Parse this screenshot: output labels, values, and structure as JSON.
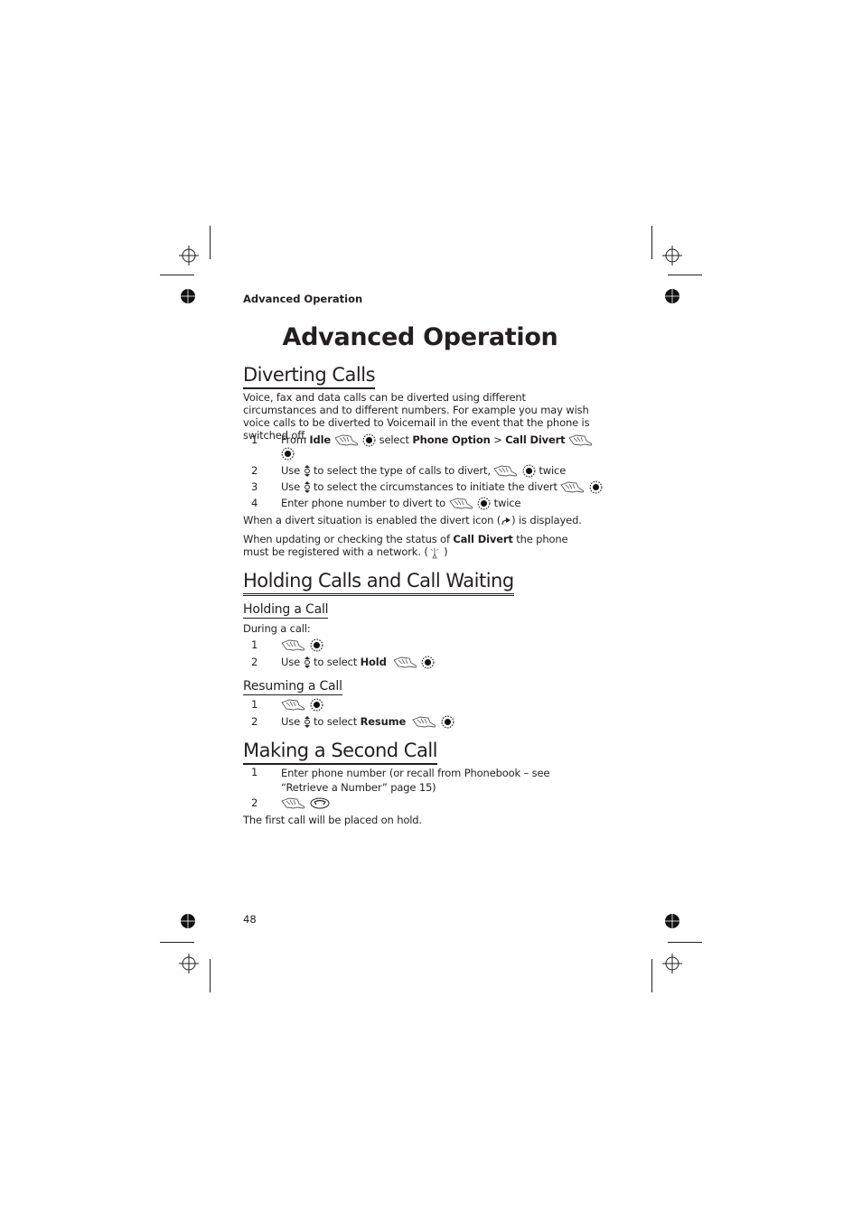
{
  "running_header": "Advanced Operation",
  "page_title": "Advanced Operation",
  "page_number": "48",
  "sections": {
    "diverting": {
      "heading": "Diverting Calls",
      "intro": "Voice, fax and data calls can be diverted using different circumstances and to different numbers. For example you may wish voice calls to be diverted to Voicemail in the event that the phone is switched off.",
      "steps": [
        {
          "num": "1",
          "pre": "From ",
          "b1": "Idle",
          "mid": " select ",
          "b2": "Phone Option",
          "gt": " > ",
          "b3": "Call Divert"
        },
        {
          "num": "2",
          "pre": "Use ",
          "mid": " to select the type of calls to divert, ",
          "post": " twice"
        },
        {
          "num": "3",
          "pre": "Use ",
          "mid": " to select the circumstances to initiate the divert "
        },
        {
          "num": "4",
          "pre": "Enter phone number to divert to ",
          "post": " twice"
        }
      ],
      "note1_pre": "When a divert situation is enabled the divert icon (",
      "note1_post": ") is displayed.",
      "note2_pre": "When updating or checking the status of ",
      "note2_bold": "Call Divert",
      "note2_post": " the phone must be registered with a network. (",
      "note2_end": " )"
    },
    "holding": {
      "heading": "Holding Calls and Call Waiting",
      "sub1": {
        "heading": "Holding a Call",
        "intro": "During a call:",
        "steps": [
          {
            "num": "1"
          },
          {
            "num": "2",
            "pre": "Use ",
            "mid": "  to select ",
            "bold": "Hold"
          }
        ]
      },
      "sub2": {
        "heading": "Resuming a Call",
        "steps": [
          {
            "num": "1"
          },
          {
            "num": "2",
            "pre": "Use ",
            "mid": " to select ",
            "bold": "Resume"
          }
        ]
      }
    },
    "second": {
      "heading": "Making a Second Call",
      "steps": [
        {
          "num": "1",
          "text": "Enter phone number (or recall from Phonebook – see “Retrieve a Number” page 15)"
        },
        {
          "num": "2"
        }
      ],
      "footer": "The first call will be placed on hold."
    }
  },
  "icons": {
    "softkey": "hand-softkey-icon",
    "ok": "ok-button-icon",
    "nav": "up-down-navigation-icon",
    "divert": "divert-status-icon",
    "network": "network-antenna-icon",
    "call": "call-button-icon"
  }
}
